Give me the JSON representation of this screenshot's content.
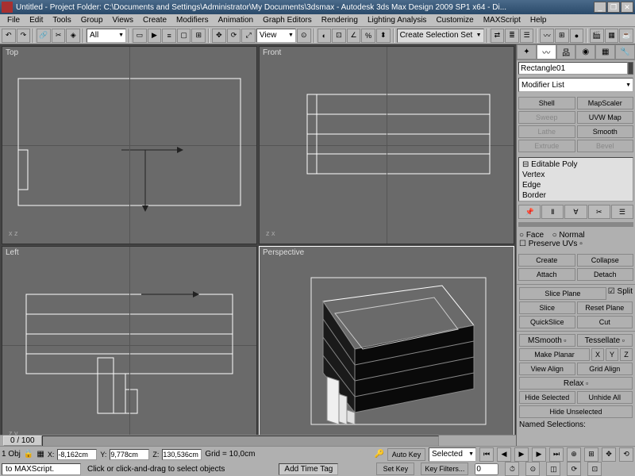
{
  "title": "Untitled    - Project Folder: C:\\Documents and Settings\\Administrator\\My Documents\\3dsmax    - Autodesk 3ds Max Design 2009 SP1  x64    - Di...",
  "menu": [
    "File",
    "Edit",
    "Tools",
    "Group",
    "Views",
    "Create",
    "Modifiers",
    "Animation",
    "Graph Editors",
    "Rendering",
    "Lighting Analysis",
    "Customize",
    "MAXScript",
    "Help"
  ],
  "toolbar": {
    "all": "All",
    "view": "View",
    "selset": "Create Selection Set"
  },
  "viewports": {
    "top": "Top",
    "front": "Front",
    "left": "Left",
    "persp": "Perspective"
  },
  "cmd": {
    "objname": "Rectangle01",
    "modlist": "Modifier List",
    "btns": [
      [
        "Shell",
        "MapScaler"
      ],
      [
        "Sweep",
        "UVW Map"
      ],
      [
        "Lathe",
        "Smooth"
      ],
      [
        "Extrude",
        "Bevel"
      ]
    ],
    "stack": [
      "⊟ Editable Poly",
      "      Vertex",
      "      Edge",
      "      Border"
    ],
    "sel": {
      "face": "Face",
      "normal": "Normal",
      "preserve": "Preserve UVs"
    },
    "edit": [
      [
        "Create",
        "Collapse"
      ],
      [
        "Attach",
        "Detach"
      ]
    ],
    "slice": {
      "sliceplane": "Slice Plane",
      "split": "Split",
      "slice": "Slice",
      "reset": "Reset Plane",
      "quick": "QuickSlice",
      "cut": "Cut"
    },
    "geom": {
      "msmooth": "MSmooth",
      "tess": "Tessellate",
      "planar": "Make Planar",
      "x": "X",
      "y": "Y",
      "z": "Z",
      "valign": "View Align",
      "galign": "Grid Align",
      "relax": "Relax",
      "hidesel": "Hide Selected",
      "unhide": "Unhide All",
      "hideun": "Hide Unselected",
      "named": "Named Selections:"
    }
  },
  "timeline": {
    "frame": "0 / 100"
  },
  "status": {
    "objcount": "1 Obj",
    "x": "-8,162cm",
    "y": "9,778cm",
    "z": "130,536cm",
    "grid": "Grid = 10,0cm",
    "autokey": "Auto Key",
    "setkey": "Set Key",
    "selected": "Selected",
    "keyfilters": "Key Filters...",
    "addtag": "Add Time Tag"
  },
  "prompt": {
    "maxscript": "to MAXScript.",
    "hint": "Click or click-and-drag to select objects"
  }
}
